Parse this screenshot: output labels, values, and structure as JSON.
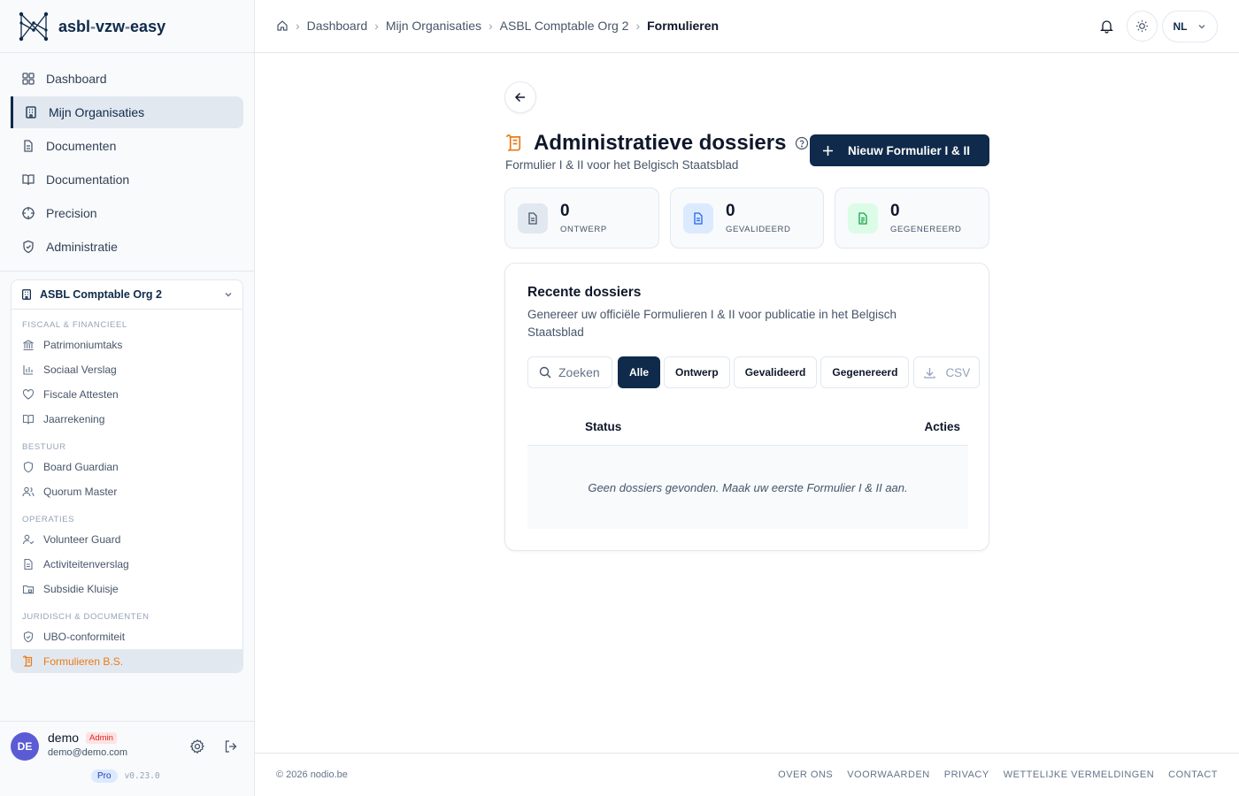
{
  "app": {
    "logo_part1": "asbl",
    "logo_sep1": "-",
    "logo_part2": "vzw",
    "logo_sep2": "-",
    "logo_part3": "easy"
  },
  "nav": [
    {
      "label": "Dashboard",
      "icon": "dashboard-icon"
    },
    {
      "label": "Mijn Organisaties",
      "icon": "building-icon",
      "active": true
    },
    {
      "label": "Documenten",
      "icon": "document-icon"
    },
    {
      "label": "Documentation",
      "icon": "book-icon"
    },
    {
      "label": "Precision",
      "icon": "crosshair-icon"
    },
    {
      "label": "Administratie",
      "icon": "shield-icon"
    }
  ],
  "org": {
    "name": "ASBL Comptable Org 2",
    "groups": [
      {
        "title": "FISCAAL & FINANCIEEL",
        "items": [
          "Patrimoniumtaks",
          "Sociaal Verslag",
          "Fiscale Attesten",
          "Jaarrekening"
        ]
      },
      {
        "title": "BESTUUR",
        "items": [
          "Board Guardian",
          "Quorum Master"
        ]
      },
      {
        "title": "OPERATIES",
        "items": [
          "Volunteer Guard",
          "Activiteitenverslag",
          "Subsidie Kluisje"
        ]
      },
      {
        "title": "JURIDISCH & DOCUMENTEN",
        "items": [
          "UBO-conformiteit",
          "Formulieren B.S."
        ]
      }
    ],
    "active_item": "Formulieren B.S."
  },
  "user": {
    "initials": "DE",
    "name": "demo",
    "role": "Admin",
    "email": "demo@demo.com",
    "plan": "Pro",
    "version": "v0.23.0"
  },
  "breadcrumb": [
    "Dashboard",
    "Mijn Organisaties",
    "ASBL Comptable Org 2",
    "Formulieren"
  ],
  "header": {
    "lang": "NL"
  },
  "page": {
    "title": "Administratieve dossiers",
    "subtitle": "Formulier I & II voor het Belgisch Staatsblad",
    "new_button": "Nieuw Formulier I & II"
  },
  "stats": [
    {
      "value": "0",
      "label": "ONTWERP"
    },
    {
      "value": "0",
      "label": "GEVALIDEERD"
    },
    {
      "value": "0",
      "label": "GEGENEREERD"
    }
  ],
  "recent": {
    "title": "Recente dossiers",
    "description": "Genereer uw officiële Formulieren I & II voor publicatie in het Belgisch Staatsblad",
    "search_placeholder": "Zoeken",
    "filters": [
      "Alle",
      "Ontwerp",
      "Gevalideerd",
      "Gegenereerd"
    ],
    "active_filter": "Alle",
    "csv": "CSV",
    "columns": [
      "Status",
      "Acties"
    ],
    "empty": "Geen dossiers gevonden. Maak uw eerste Formulier I & II aan."
  },
  "footer": {
    "copyright": "© 2026 nodio.be",
    "links": [
      "OVER ONS",
      "VOORWAARDEN",
      "PRIVACY",
      "WETTELIJKE VERMELDINGEN",
      "CONTACT"
    ]
  },
  "colors": {
    "primary": "#0f2a4a",
    "accent": "#ea7a17",
    "avatar": "#5b5bd6"
  }
}
